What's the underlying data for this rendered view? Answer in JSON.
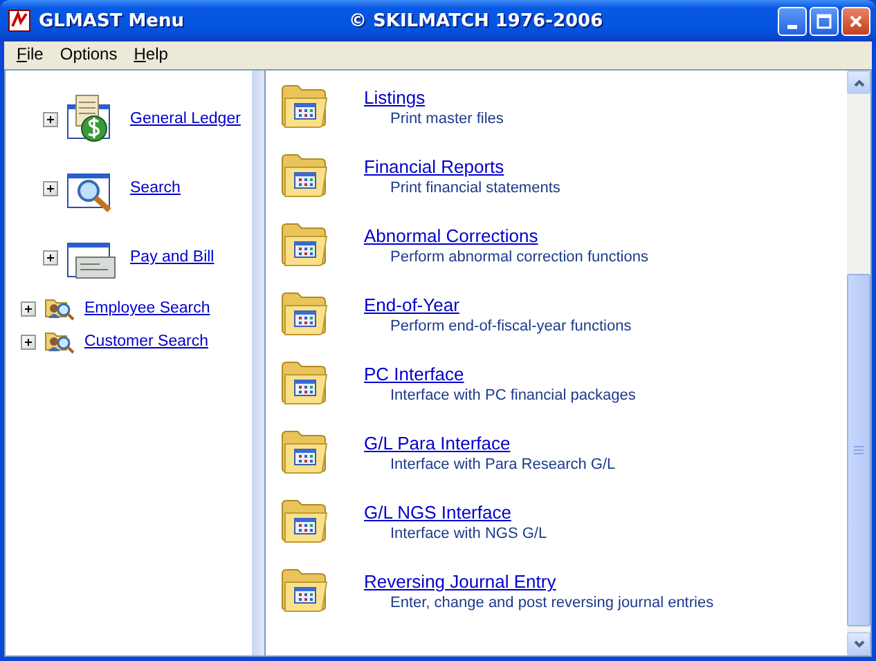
{
  "window": {
    "title": "GLMAST Menu",
    "caption": "© SKILMATCH 1976-2006"
  },
  "menu": [
    {
      "label": "File",
      "first_letter_underlined": true
    },
    {
      "label": "Options",
      "first_letter_underlined": false
    },
    {
      "label": "Help",
      "first_letter_underlined": true
    }
  ],
  "sidebar": {
    "items": [
      {
        "label": "General Ledger",
        "kind": "large",
        "expanded": false
      },
      {
        "label": "Search",
        "kind": "large",
        "expanded": false
      },
      {
        "label": "Pay and Bill",
        "kind": "large",
        "expanded": false
      },
      {
        "label": "Employee Search",
        "kind": "small",
        "expanded": false
      },
      {
        "label": "Customer Search",
        "kind": "small",
        "expanded": false
      }
    ]
  },
  "entries": [
    {
      "title": "Listings",
      "description": "Print master files"
    },
    {
      "title": "Financial Reports",
      "description": "Print financial statements"
    },
    {
      "title": "Abnormal Corrections",
      "description": "Perform abnormal correction functions"
    },
    {
      "title": "End-of-Year",
      "description": "Perform end-of-fiscal-year functions"
    },
    {
      "title": "PC Interface",
      "description": "Interface with PC financial packages"
    },
    {
      "title": "G/L Para Interface",
      "description": "Interface with Para Research G/L"
    },
    {
      "title": "G/L NGS Interface",
      "description": "Interface with NGS G/L"
    },
    {
      "title": "Reversing Journal Entry",
      "description": "Enter, change and post reversing journal entries"
    }
  ]
}
